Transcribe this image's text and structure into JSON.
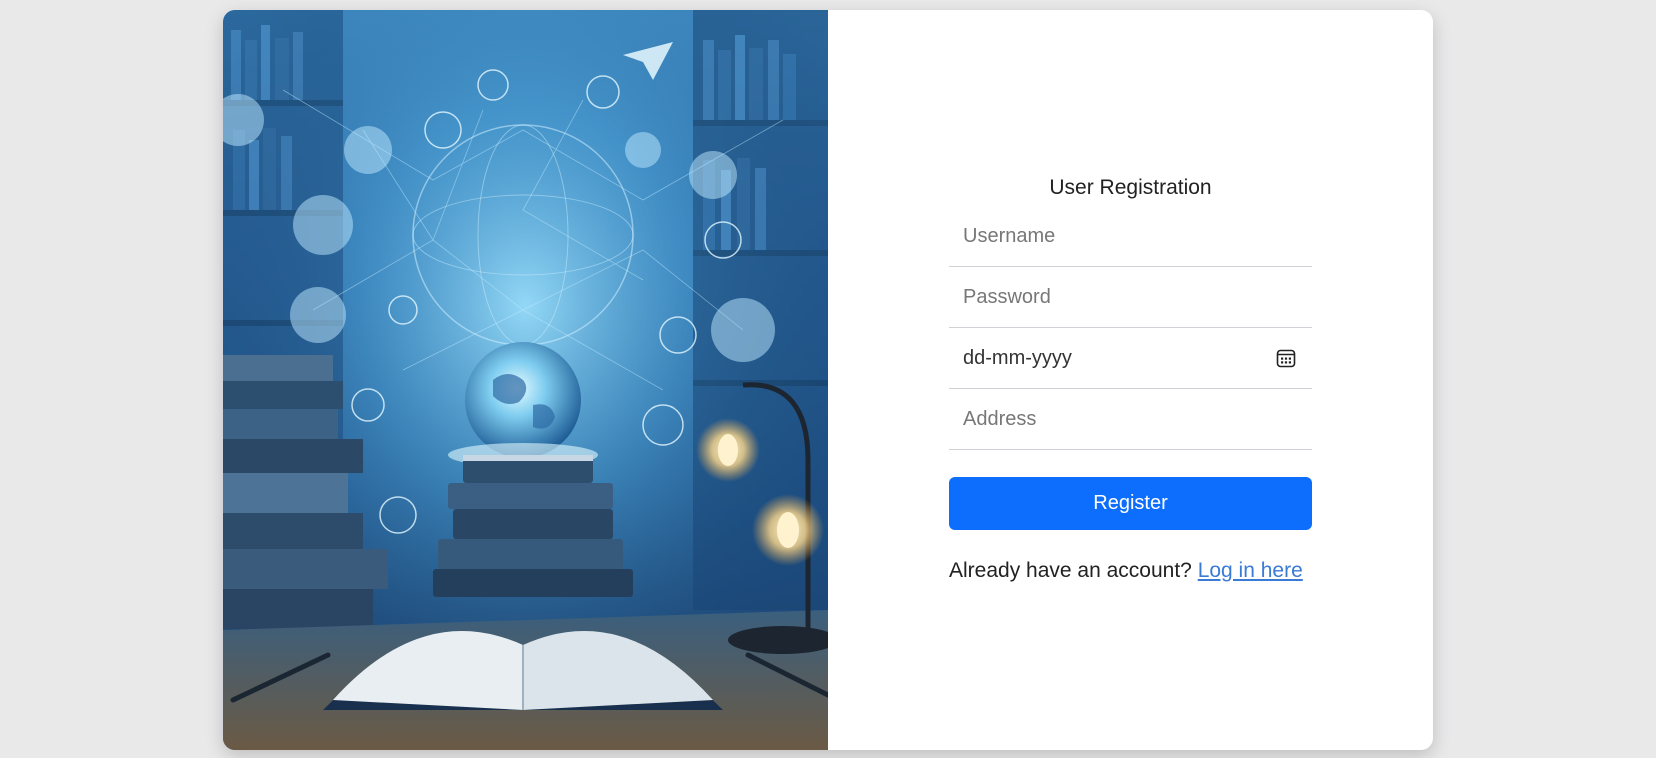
{
  "hero": {
    "image_description_icon": "library-globe-illustration"
  },
  "form": {
    "title": "User Registration",
    "username_placeholder": "Username",
    "password_placeholder": "Password",
    "dob_placeholder": "dd-mm-yyyy",
    "address_placeholder": "Address",
    "register_label": "Register",
    "login_prompt": "Already have an account?",
    "login_link": "Log in here"
  },
  "colors": {
    "primary": "#0d6efd",
    "link": "#3a7bd5",
    "page_bg": "#e9e9ea"
  }
}
